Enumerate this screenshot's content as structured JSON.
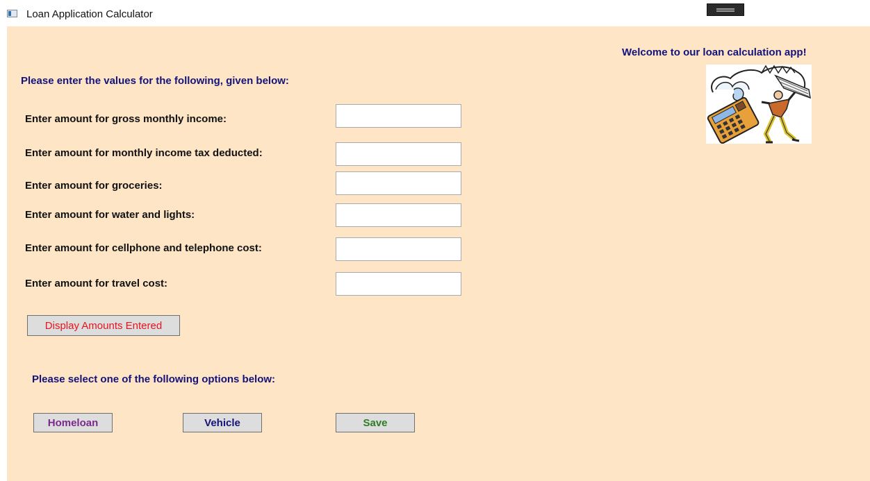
{
  "window": {
    "title": "Loan Application Calculator",
    "app_icon": "window-app-icon"
  },
  "welcome_text": "Welcome to our loan calculation app!",
  "clipart": {
    "icon": "calculator-clipart-icon",
    "colors": {
      "calculator": "#e8a13a",
      "shirt": "#c96a2c",
      "pants": "#d7c22e",
      "tape": "#5b89c6"
    }
  },
  "form": {
    "heading": "Please enter the values for the following, given below:",
    "fields": [
      {
        "label": "Enter amount for gross monthly income:",
        "value": "",
        "placeholder": ""
      },
      {
        "label": "Enter amount for monthly income tax deducted:",
        "value": "",
        "placeholder": ""
      },
      {
        "label": "Enter amount for groceries:",
        "value": "",
        "placeholder": ""
      },
      {
        "label": "Enter amount for water and lights:",
        "value": "",
        "placeholder": ""
      },
      {
        "label": "Enter amount for cellphone and telephone cost:",
        "value": "",
        "placeholder": ""
      },
      {
        "label": "Enter amount for travel cost:",
        "value": "",
        "placeholder": ""
      }
    ],
    "display_button": {
      "label": "Display Amounts Entered",
      "color": "#e8141d"
    }
  },
  "options": {
    "heading": "Please select one of the following options below:",
    "buttons": [
      {
        "label": "Homeloan",
        "color": "#7a2a8a"
      },
      {
        "label": "Vehicle",
        "color": "#14137a"
      },
      {
        "label": "Save",
        "color": "#2f7d23"
      }
    ]
  },
  "theme": {
    "background": "#fde5c6",
    "heading_color": "#14137a"
  }
}
